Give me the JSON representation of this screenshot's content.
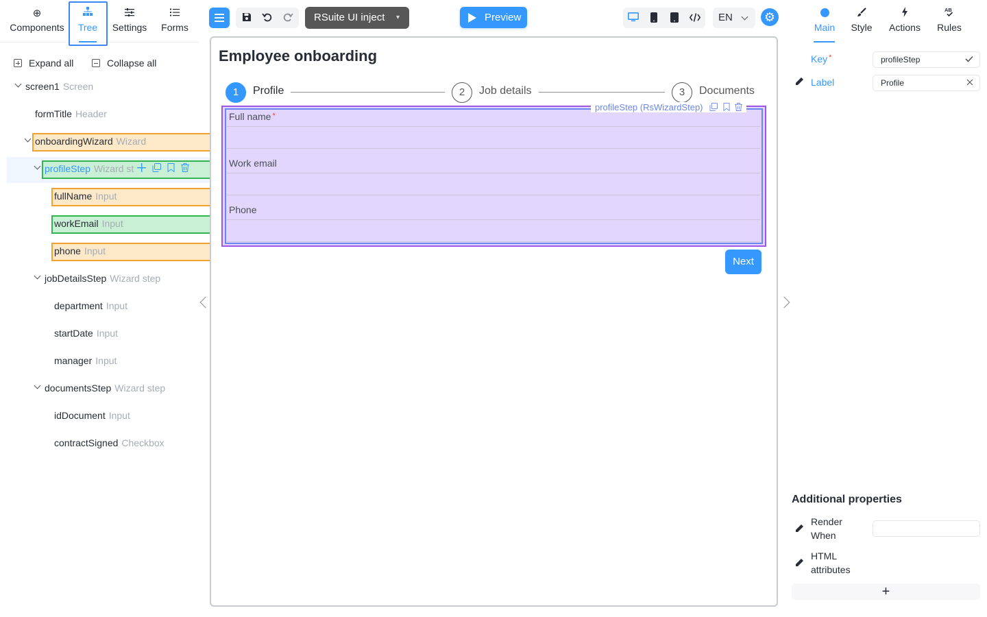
{
  "left_tabs": [
    {
      "label": "Components",
      "icon": "plus-circle-icon"
    },
    {
      "label": "Tree",
      "icon": "tree-icon",
      "active": true
    },
    {
      "label": "Settings",
      "icon": "sliders-icon"
    },
    {
      "label": "Forms",
      "icon": "list-icon"
    }
  ],
  "tree_controls": {
    "expand_all": "Expand all",
    "collapse_all": "Collapse all"
  },
  "tree": [
    {
      "name": "screen1",
      "type": "Screen"
    },
    {
      "name": "formTitle",
      "type": "Header"
    },
    {
      "name": "onboardingWizard",
      "type": "Wizard"
    },
    {
      "name": "profileStep",
      "type": "Wizard st"
    },
    {
      "name": "fullName",
      "type": "Input"
    },
    {
      "name": "workEmail",
      "type": "Input"
    },
    {
      "name": "phone",
      "type": "Input"
    },
    {
      "name": "jobDetailsStep",
      "type": "Wizard step"
    },
    {
      "name": "department",
      "type": "Input"
    },
    {
      "name": "startDate",
      "type": "Input"
    },
    {
      "name": "manager",
      "type": "Input"
    },
    {
      "name": "documentsStep",
      "type": "Wizard step"
    },
    {
      "name": "idDocument",
      "type": "Input"
    },
    {
      "name": "contractSigned",
      "type": "Checkbox"
    }
  ],
  "toolbar": {
    "inject_select": "RSuite UI inject",
    "preview_label": "Preview",
    "language": "EN"
  },
  "form": {
    "title": "Employee onboarding",
    "steps": [
      {
        "number": "1",
        "label": "Profile",
        "active": true
      },
      {
        "number": "2",
        "label": "Job details"
      },
      {
        "number": "3",
        "label": "Documents"
      }
    ],
    "selection_caption": "profileStep (RsWizardStep)",
    "fields": [
      {
        "label": "Full name",
        "required": "*"
      },
      {
        "label": "Work email"
      },
      {
        "label": "Phone"
      }
    ],
    "next_label": "Next"
  },
  "right_tabs": [
    {
      "label": "Main",
      "icon": "circle-icon",
      "active": true
    },
    {
      "label": "Style",
      "icon": "brush-icon"
    },
    {
      "label": "Actions",
      "icon": "bolt-icon"
    },
    {
      "label": "Rules",
      "icon": "spellcheck-icon"
    }
  ],
  "props": {
    "key_label": "Key",
    "key_required": "*",
    "key_value": "profileStep",
    "label_label": "Label",
    "label_value": "Profile"
  },
  "additional": {
    "title": "Additional properties",
    "render_when": "Render When",
    "html_attributes": "HTML attributes",
    "add_symbol": "+"
  },
  "colors": {
    "accent": "#3498ff",
    "highlight_orange": "#f0a22e",
    "highlight_green": "#31b553",
    "selection_purple": "#9d55e6"
  }
}
